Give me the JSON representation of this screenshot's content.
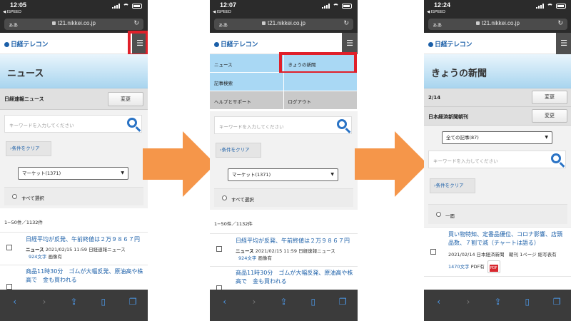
{
  "url": "t21.nikkei.co.jp",
  "aa": "ぁあ",
  "back_label": "◀ ISPEED",
  "logo": "日経テレコン",
  "menu_icon": "hamburger-icon",
  "colors": {
    "highlight": "#e0202a",
    "arrow": "#f5964a",
    "link": "#1b5fa8",
    "menu_bg": "#a9d8f4"
  },
  "phone1": {
    "time": "12:05",
    "page_title": "ニュース",
    "source_label": "日経速報ニュース",
    "change_label": "変更",
    "search_placeholder": "キーワードを入力してください",
    "clear_label": "›条件をクリア",
    "select_value": "マーケット(1371)",
    "select_all": "すべて選択",
    "count": "1−50件／1132件",
    "articles": [
      {
        "title": "日経平均が反発、午前終値は２万９８６７円",
        "meta_bold": "ニュース",
        "meta_rest": "2021/02/15 11:59 日経速報ニュース",
        "meta2_blue": "924文字",
        "meta2_rest": " 画像有"
      },
      {
        "title": "商品11時30分　ゴムが大幅反発、原油高や株高で　金も買われる"
      }
    ]
  },
  "phone2": {
    "time": "12:07",
    "menu": {
      "news": "ニュース",
      "today": "きょうの新聞",
      "article_search": "記事検索",
      "help": "ヘルプとサポート",
      "logout": "ログアウト"
    },
    "search_placeholder": "キーワードを入力してください",
    "clear_label": "›条件をクリア",
    "select_value": "マーケット(1371)",
    "select_all": "すべて選択",
    "count": "1−50件／1132件",
    "articles": [
      {
        "title": "日経平均が反発、午前終値は２万９８６７円",
        "meta_bold": "ニュース",
        "meta_rest": "2021/02/15 11:59 日経速報ニュース",
        "meta2_blue": "924文字",
        "meta2_rest": " 画像有"
      },
      {
        "title": "商品11時30分　ゴムが大幅反発、原油高や株高で　金も買われる"
      }
    ]
  },
  "phone3": {
    "time": "12:24",
    "page_title": "きょうの新聞",
    "page_label": "2/14",
    "paper_label": "日本経済新聞朝刊",
    "change_label": "変更",
    "select_value": "全ての記事(87)",
    "search_placeholder": "キーワードを入力してください",
    "clear_label": "›条件をクリア",
    "section_label": "一面",
    "article": {
      "title": "買い物特知、定番品優位、コロナ影響、店頭品数、７割で減（チャートは語る）",
      "meta": "2021/02/14 日本経済新聞　朝刊 1ページ 総写表有",
      "meta2_blue": "1470文字",
      "meta2_rest": " PDF有"
    }
  },
  "toolbar": [
    "back-icon",
    "forward-icon",
    "share-icon",
    "bookmarks-icon",
    "tabs-icon"
  ]
}
